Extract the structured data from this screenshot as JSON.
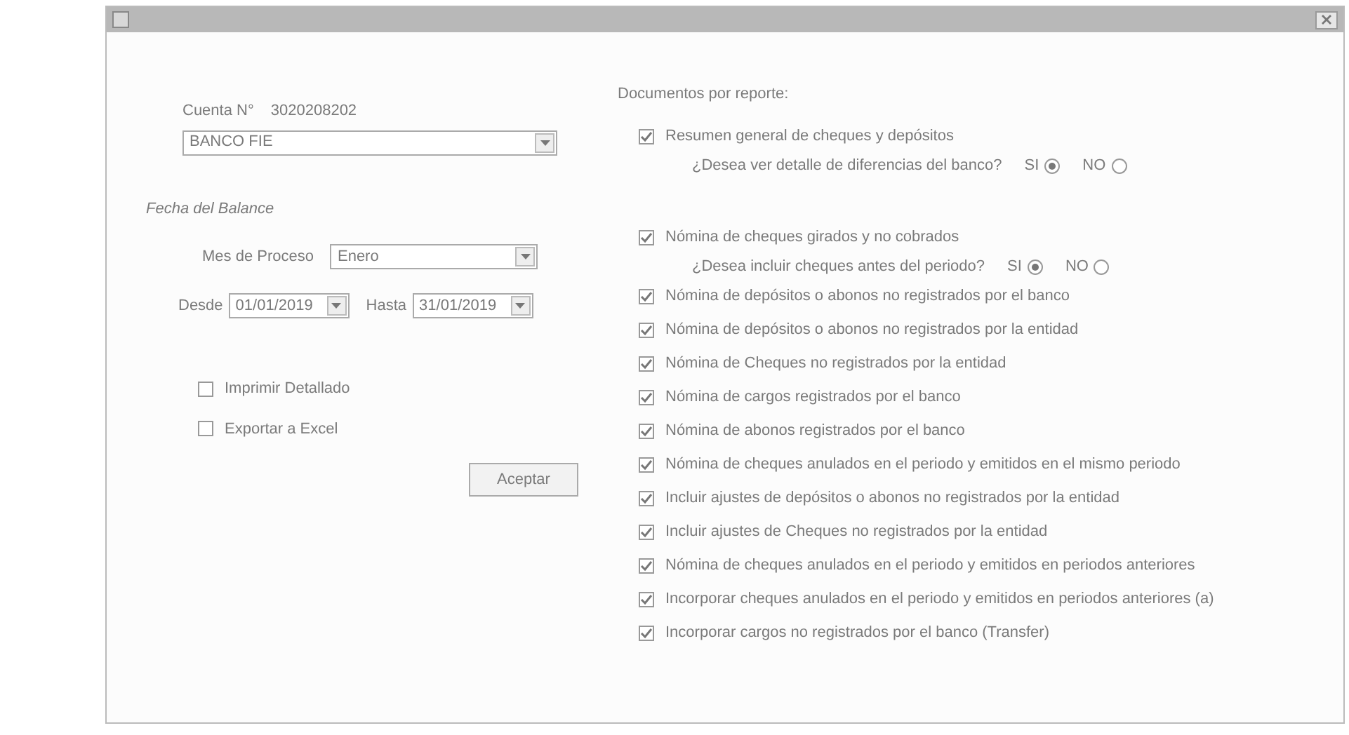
{
  "account": {
    "label": "Cuenta N°",
    "number": "3020208202",
    "bank": "BANCO FIE"
  },
  "period": {
    "title": "Fecha del Balance",
    "month_label": "Mes de Proceso",
    "month": "Enero",
    "from_label": "Desde",
    "from": "01/01/2019",
    "to_label": "Hasta",
    "to": "31/01/2019"
  },
  "options": [
    {
      "label": "Imprimir Detallado",
      "checked": false
    },
    {
      "label": "Exportar a Excel",
      "checked": false
    }
  ],
  "accept_button": "Aceptar",
  "reports": {
    "title": "Documentos por reporte:",
    "items": [
      {
        "label": "Resumen general de cheques y depósitos",
        "checked": true,
        "question": {
          "text": "¿Desea ver detalle de diferencias del banco?",
          "choices": [
            {
              "label": "SI",
              "selected": true
            },
            {
              "label": "NO",
              "selected": false
            }
          ]
        }
      },
      {
        "label": "Nómina de cheques girados y no cobrados",
        "checked": true,
        "question": {
          "text": "¿Desea incluir cheques antes del periodo?",
          "choices": [
            {
              "label": "SI",
              "selected": true
            },
            {
              "label": "NO",
              "selected": false
            }
          ]
        }
      },
      {
        "label": "Nómina de depósitos o abonos no registrados por el banco",
        "checked": true
      },
      {
        "label": "Nómina de depósitos o abonos no registrados por la entidad",
        "checked": true
      },
      {
        "label": "Nómina de Cheques no registrados por la entidad",
        "checked": true
      },
      {
        "label": "Nómina de cargos registrados por el banco",
        "checked": true
      },
      {
        "label": "Nómina de abonos registrados por el banco",
        "checked": true
      },
      {
        "label": "Nómina de cheques anulados en el periodo y emitidos en el mismo periodo",
        "checked": true
      },
      {
        "label": "Incluir ajustes de depósitos o abonos no registrados por la entidad",
        "checked": true
      },
      {
        "label": "Incluir ajustes de Cheques no registrados por la entidad",
        "checked": true
      },
      {
        "label": "Nómina de cheques anulados en el periodo y emitidos en periodos anteriores",
        "checked": true
      },
      {
        "label": "Incorporar cheques anulados en el periodo y emitidos en periodos anteriores (a)",
        "checked": true
      },
      {
        "label": "Incorporar cargos no registrados por el banco (Transfer)",
        "checked": true
      }
    ]
  }
}
